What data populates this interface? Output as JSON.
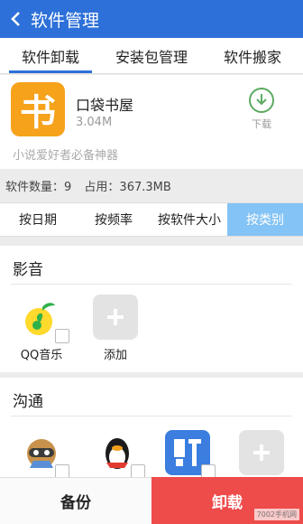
{
  "header": {
    "title": "软件管理"
  },
  "tabs": [
    {
      "label": "软件卸载"
    },
    {
      "label": "安装包管理"
    },
    {
      "label": "软件搬家"
    }
  ],
  "promo": {
    "icon_char": "书",
    "name": "口袋书屋",
    "size": "3.04M",
    "description": "小说爱好者必备神器",
    "download_label": "下载"
  },
  "stats": {
    "count_text": "软件数量：9",
    "usage_text": "占用：367.3MB"
  },
  "sort": [
    {
      "label": "按日期"
    },
    {
      "label": "按频率"
    },
    {
      "label": "按软件大小"
    },
    {
      "label": "按类别"
    }
  ],
  "categories": {
    "media": {
      "title": "影音",
      "apps": [
        {
          "label": "QQ音乐"
        },
        {
          "label": "添加"
        }
      ]
    },
    "comm": {
      "title": "沟通"
    }
  },
  "bottom": {
    "backup_label": "备份",
    "uninstall_label": "卸载"
  },
  "watermark": "7002手机网",
  "colors": {
    "primary": "#2d70d9",
    "uninstall": "#ee4b4b",
    "sort_active": "#84c3f5"
  }
}
